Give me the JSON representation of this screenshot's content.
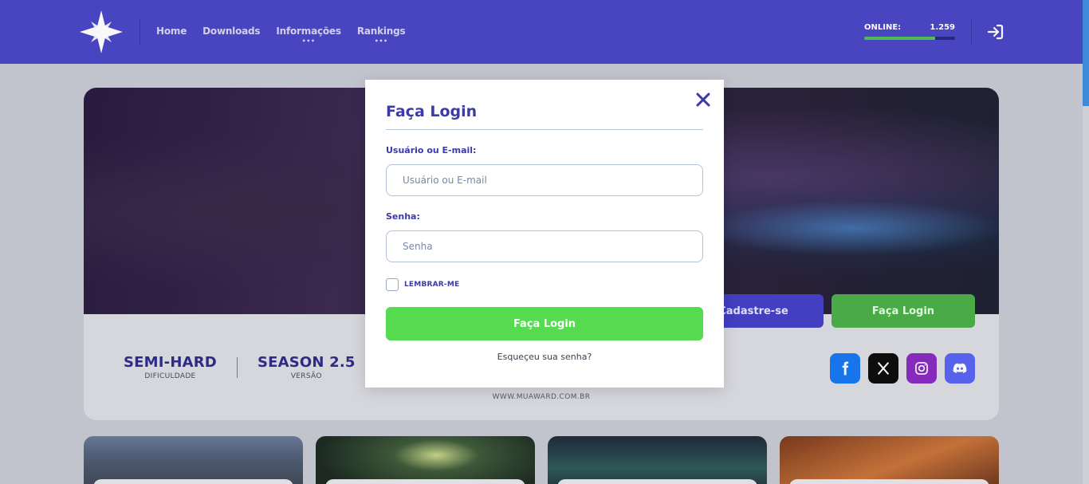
{
  "header": {
    "nav": [
      {
        "label": "Home",
        "has_submenu": false
      },
      {
        "label": "Downloads",
        "has_submenu": false
      },
      {
        "label": "Informações",
        "has_submenu": true
      },
      {
        "label": "Rankings",
        "has_submenu": true
      }
    ],
    "submenu_indicator": "•••",
    "online_label": "ONLINE:",
    "online_count": "1.259",
    "online_fill_percent": 78,
    "login_icon": "sign-in-icon"
  },
  "hero": {
    "register_label": "Cadastre-se",
    "login_label": "Faça Login",
    "stats": [
      {
        "value": "SEMI-HARD",
        "label": "DIFICULDADE"
      },
      {
        "value": "SEASON 2.5",
        "label": "VERSÃO"
      }
    ],
    "site_url": "WWW.MUAWARD.COM.BR",
    "socials": [
      {
        "name": "facebook-icon",
        "color": "#1877f2"
      },
      {
        "name": "x-icon",
        "color": "#0d0d0d"
      },
      {
        "name": "instagram-icon",
        "color": "#8a2bc2"
      },
      {
        "name": "discord-icon",
        "color": "#5865f2"
      }
    ]
  },
  "modal": {
    "title": "Faça Login",
    "user_label": "Usuário ou E-mail:",
    "user_placeholder": "Usuário ou E-mail",
    "password_label": "Senha:",
    "password_placeholder": "Senha",
    "remember_label": "LEMBRAR-ME",
    "submit_label": "Faça Login",
    "forgot_label": "Esqueçeu sua senha?"
  },
  "colors": {
    "header_bg": "#4b47c7",
    "accent": "#3c3aa8",
    "success": "#55da50",
    "page_bg": "#c7c9d3"
  }
}
